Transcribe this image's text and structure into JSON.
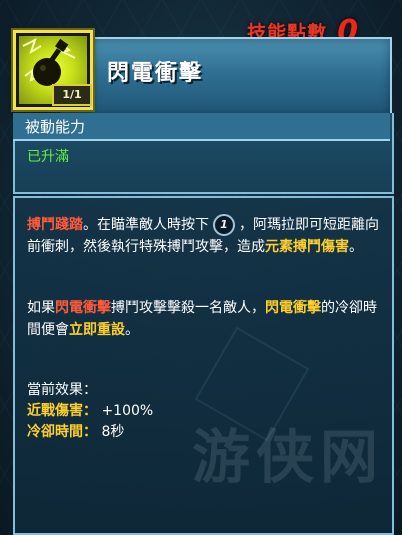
{
  "header": {
    "skill_points_label": "技能點數",
    "skill_points_value": "0"
  },
  "skill": {
    "title": "閃電衝擊",
    "rank": "1/1",
    "type": "被動能力",
    "status": "已升滿",
    "icon": "lightning-fist-icon"
  },
  "description": {
    "p1_part1": "搏鬥踐踏",
    "p1_part2": "。在瞄準敵人時按下",
    "p1_key": "1",
    "p1_part3": "，阿瑪拉即可短距離向前衝刺，然後執行特殊搏鬥攻擊，造成",
    "p1_part4": "元素搏鬥傷害",
    "p1_part5": "。",
    "p2_part1": "如果",
    "p2_part2": "閃電衝擊",
    "p2_part3": "搏鬥攻擊擊殺一名敵人，",
    "p2_part4": "閃電衝擊",
    "p2_part5": "的冷卻時間便會",
    "p2_part6": "立即重設",
    "p2_part7": "。"
  },
  "effects": {
    "title": "當前效果：",
    "rows": [
      {
        "name": "近戰傷害：",
        "value": "+100%"
      },
      {
        "name": "冷卻時間：",
        "value": "8秒"
      }
    ]
  },
  "colors": {
    "highlight": "#ffcf2a",
    "points_red": "#e23a2a",
    "status_green": "#66ee44"
  }
}
